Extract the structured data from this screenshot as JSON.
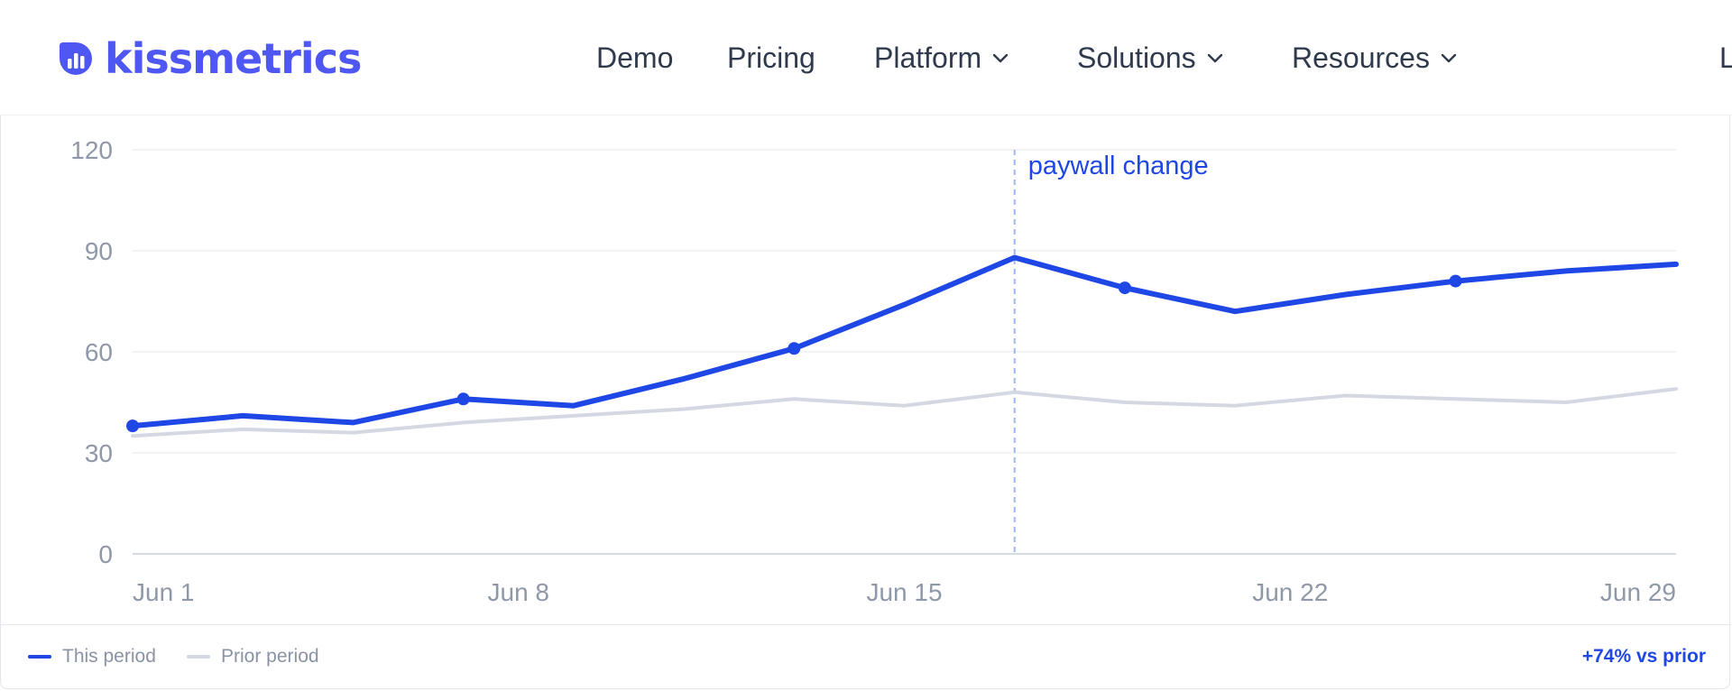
{
  "nav": {
    "logo_text": "kissmetrics",
    "items": [
      {
        "label": "Demo",
        "has_dropdown": false
      },
      {
        "label": "Pricing",
        "has_dropdown": false
      },
      {
        "label": "Platform",
        "has_dropdown": true
      },
      {
        "label": "Solutions",
        "has_dropdown": true
      },
      {
        "label": "Resources",
        "has_dropdown": true
      }
    ],
    "cutoff_label": "L"
  },
  "colors": {
    "brand": "#4f57f2",
    "this_period": "#1f47e6",
    "prior_period": "#d3d8e3",
    "annotation_line": "#9fb6ee",
    "grid": "#eef0f4",
    "tick": "#8f98a8"
  },
  "chart_data": {
    "type": "line",
    "x": [
      "Jun 1",
      "Jun 3",
      "Jun 5",
      "Jun 7",
      "Jun 9",
      "Jun 11",
      "Jun 13",
      "Jun 15",
      "Jun 17",
      "Jun 19",
      "Jun 21",
      "Jun 23",
      "Jun 25",
      "Jun 27",
      "Jun 29"
    ],
    "x_ticks": [
      "Jun 1",
      "Jun 8",
      "Jun 15",
      "Jun 22",
      "Jun 29"
    ],
    "ylim": [
      0,
      120
    ],
    "y_ticks": [
      0,
      30,
      60,
      90,
      120
    ],
    "grid": true,
    "legend_position": "bottom-left",
    "series": [
      {
        "name": "This period",
        "values": [
          38,
          41,
          39,
          46,
          44,
          52,
          61,
          74,
          88,
          79,
          72,
          77,
          81,
          84,
          86
        ],
        "markers_at": [
          0,
          3,
          6,
          9,
          12
        ]
      },
      {
        "name": "Prior period",
        "values": [
          35,
          37,
          36,
          39,
          41,
          43,
          46,
          44,
          48,
          45,
          44,
          47,
          46,
          45,
          49
        ],
        "markers_at": []
      }
    ],
    "annotations": [
      {
        "at_x": "Jun 17",
        "label": "paywall change"
      }
    ]
  },
  "footer": {
    "delta_label": "+74% vs prior"
  }
}
